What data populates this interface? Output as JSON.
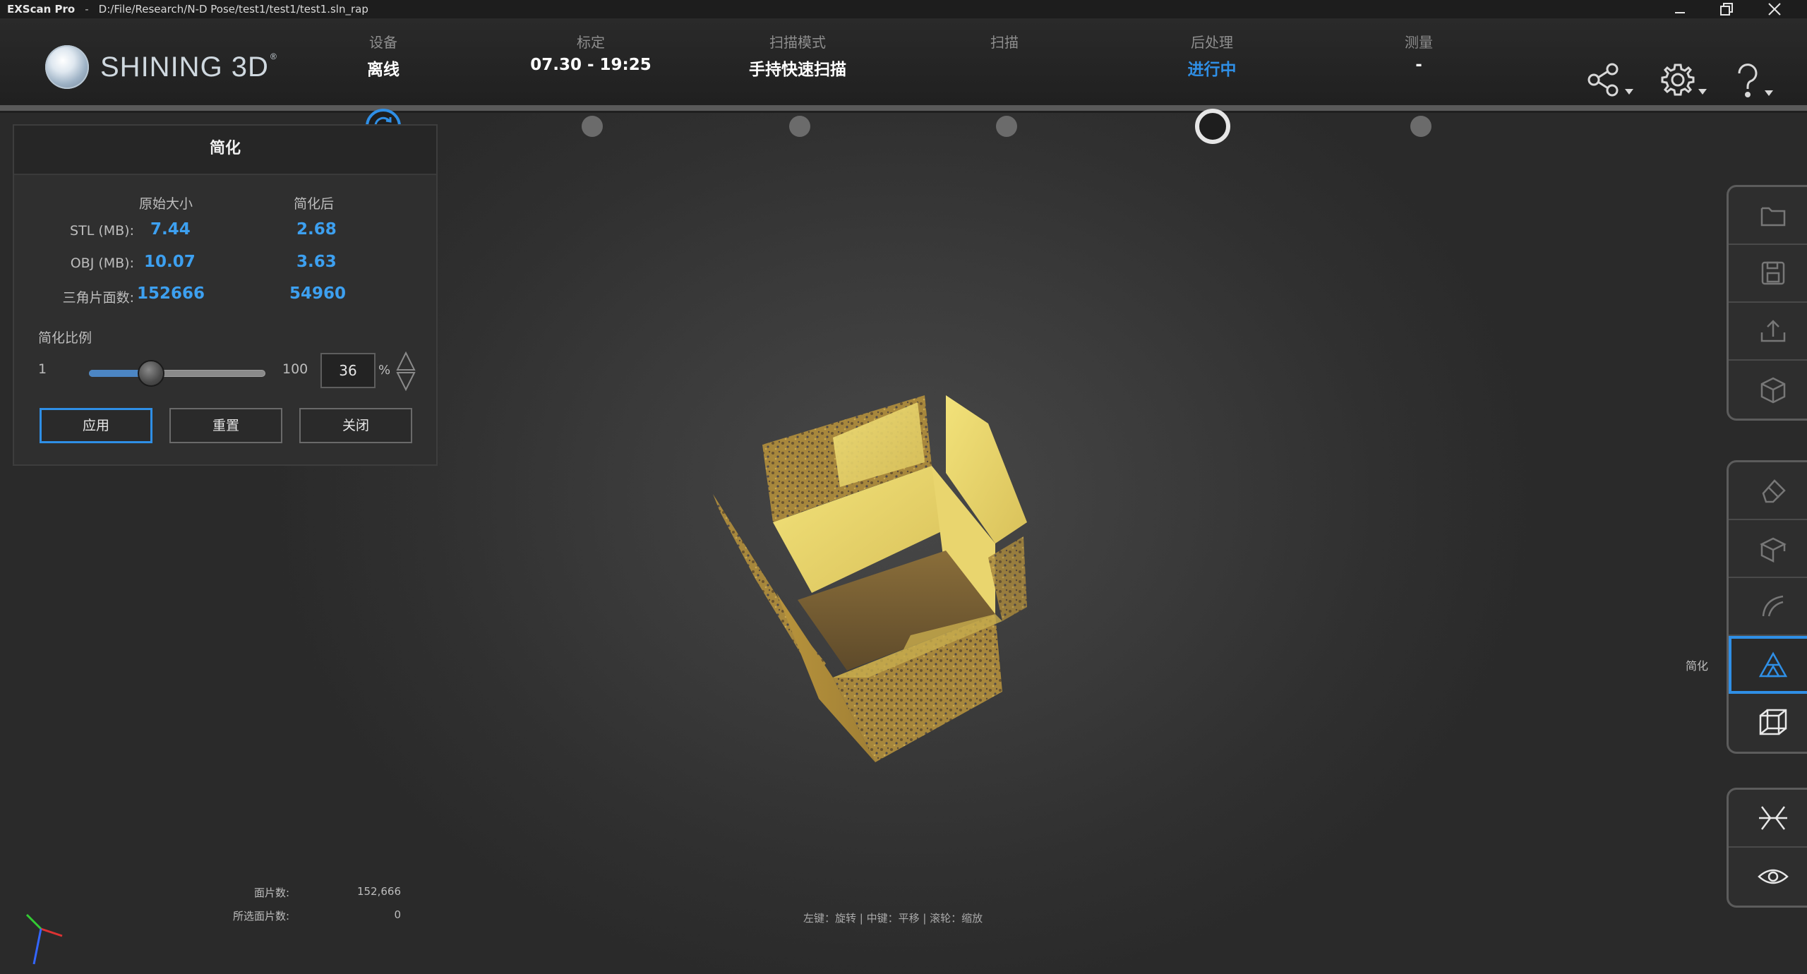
{
  "window": {
    "app_name": "EXScan Pro",
    "separator": "-",
    "file_path": "D:/File/Research/N-D Pose/test1/test1/test1.sln_rap"
  },
  "brand": {
    "name": "SHINING 3D",
    "mark": "®"
  },
  "steps": [
    {
      "label": "设备",
      "value": "离线",
      "active": false
    },
    {
      "label": "标定",
      "value": "07.30 - 19:25",
      "active": false
    },
    {
      "label": "扫描模式",
      "value": "手持快速扫描",
      "active": false
    },
    {
      "label": "扫描",
      "value": "",
      "active": false
    },
    {
      "label": "后处理",
      "value": "进行中",
      "active": true
    },
    {
      "label": "测量",
      "value": "-",
      "active": false
    }
  ],
  "header_icons": [
    "share-icon",
    "gear-icon",
    "help-icon"
  ],
  "panel": {
    "title": "简化",
    "col_original": "原始大小",
    "col_simplified": "简化后",
    "rows": [
      {
        "label": "STL (MB):",
        "original": "7.44",
        "simplified": "2.68"
      },
      {
        "label": "OBJ (MB):",
        "original": "10.07",
        "simplified": "3.63"
      },
      {
        "label": "三角片面数:",
        "original": "152666",
        "simplified": "54960"
      }
    ],
    "ratio_label": "简化比例",
    "slider": {
      "min_label": "1",
      "max_label": "100",
      "value": 36,
      "min": 1,
      "max": 100
    },
    "spin_value": "36",
    "percent_sign": "%",
    "apply_label": "应用",
    "reset_label": "重置",
    "close_label": "关闭"
  },
  "toolbar": {
    "selected_tooltip": "简化",
    "group1": [
      "folder-icon",
      "save-icon",
      "export-icon",
      "cube-icon"
    ],
    "group2": [
      "eraser-icon",
      "box-icon",
      "curve-icon",
      "simplify-icon",
      "wireframe-cube-icon"
    ],
    "group3": [
      "mirror-icon",
      "eye-icon"
    ]
  },
  "stats": {
    "faces_label": "面片数:",
    "faces_value": "152,666",
    "selected_label": "所选面片数:",
    "selected_value": "0"
  },
  "hint": "左键：旋转 | 中键：平移 | 滚轮：缩放",
  "colors": {
    "accent": "#2f8fe6",
    "value_blue": "#3da0f0",
    "model_yellow": "#e8d66a"
  }
}
